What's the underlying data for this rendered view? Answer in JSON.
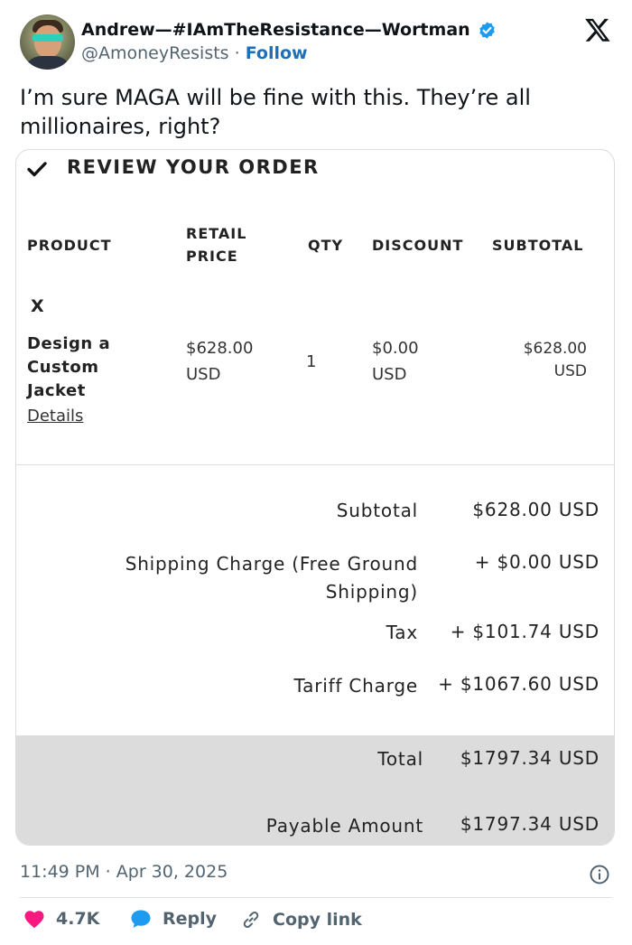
{
  "tweet": {
    "display_name": "Andrew—#IAmTheResistance—Wortman",
    "handle": "@AmoneyResists",
    "separator": "·",
    "follow_label": "Follow",
    "text": "I’m sure MAGA will be fine with this. They’re all millionaires, right?",
    "timestamp": "11:49 PM · Apr 30, 2025"
  },
  "order": {
    "heading": "REVIEW YOUR ORDER",
    "columns": {
      "product": "PRODUCT",
      "retail_price_1": "RETAIL",
      "retail_price_2": "PRICE",
      "qty": "QTY",
      "discount": "DISCOUNT",
      "subtotal": "SUBTOTAL"
    },
    "item": {
      "remove": "X",
      "name_1": "Design a",
      "name_2": "Custom",
      "name_3": "Jacket",
      "details_link": "Details",
      "price_amount": "$628.00",
      "price_currency": "USD",
      "qty": "1",
      "discount_amount": "$0.00",
      "discount_currency": "USD",
      "subtotal_amount": "$628.00",
      "subtotal_currency": "USD"
    },
    "summary": {
      "subtotal_label": "Subtotal",
      "subtotal_value": "$628.00 USD",
      "shipping_label_1": "Shipping Charge (Free Ground",
      "shipping_label_2": "Shipping)",
      "shipping_value": "+ $0.00 USD",
      "tax_label": "Tax",
      "tax_value": "+ $101.74 USD",
      "tariff_label": "Tariff Charge",
      "tariff_value": "+ $1067.60 USD",
      "total_label": "Total",
      "total_value": "$1797.34 USD",
      "payable_label": "Payable Amount",
      "payable_value": "$1797.34 USD"
    }
  },
  "actions": {
    "likes": "4.7K",
    "reply_label": "Reply",
    "copy_link_label": "Copy link"
  },
  "colors": {
    "like": "#f91880",
    "reply": "#1d9bf0",
    "verified": "#1d9bf0",
    "follow": "#1d70b8",
    "total_band": "#dcdcdc"
  },
  "icons": [
    "avatar",
    "verified-badge-icon",
    "x-logo-icon",
    "check-icon",
    "info-icon",
    "heart-icon",
    "reply-bubble-icon",
    "link-icon"
  ]
}
